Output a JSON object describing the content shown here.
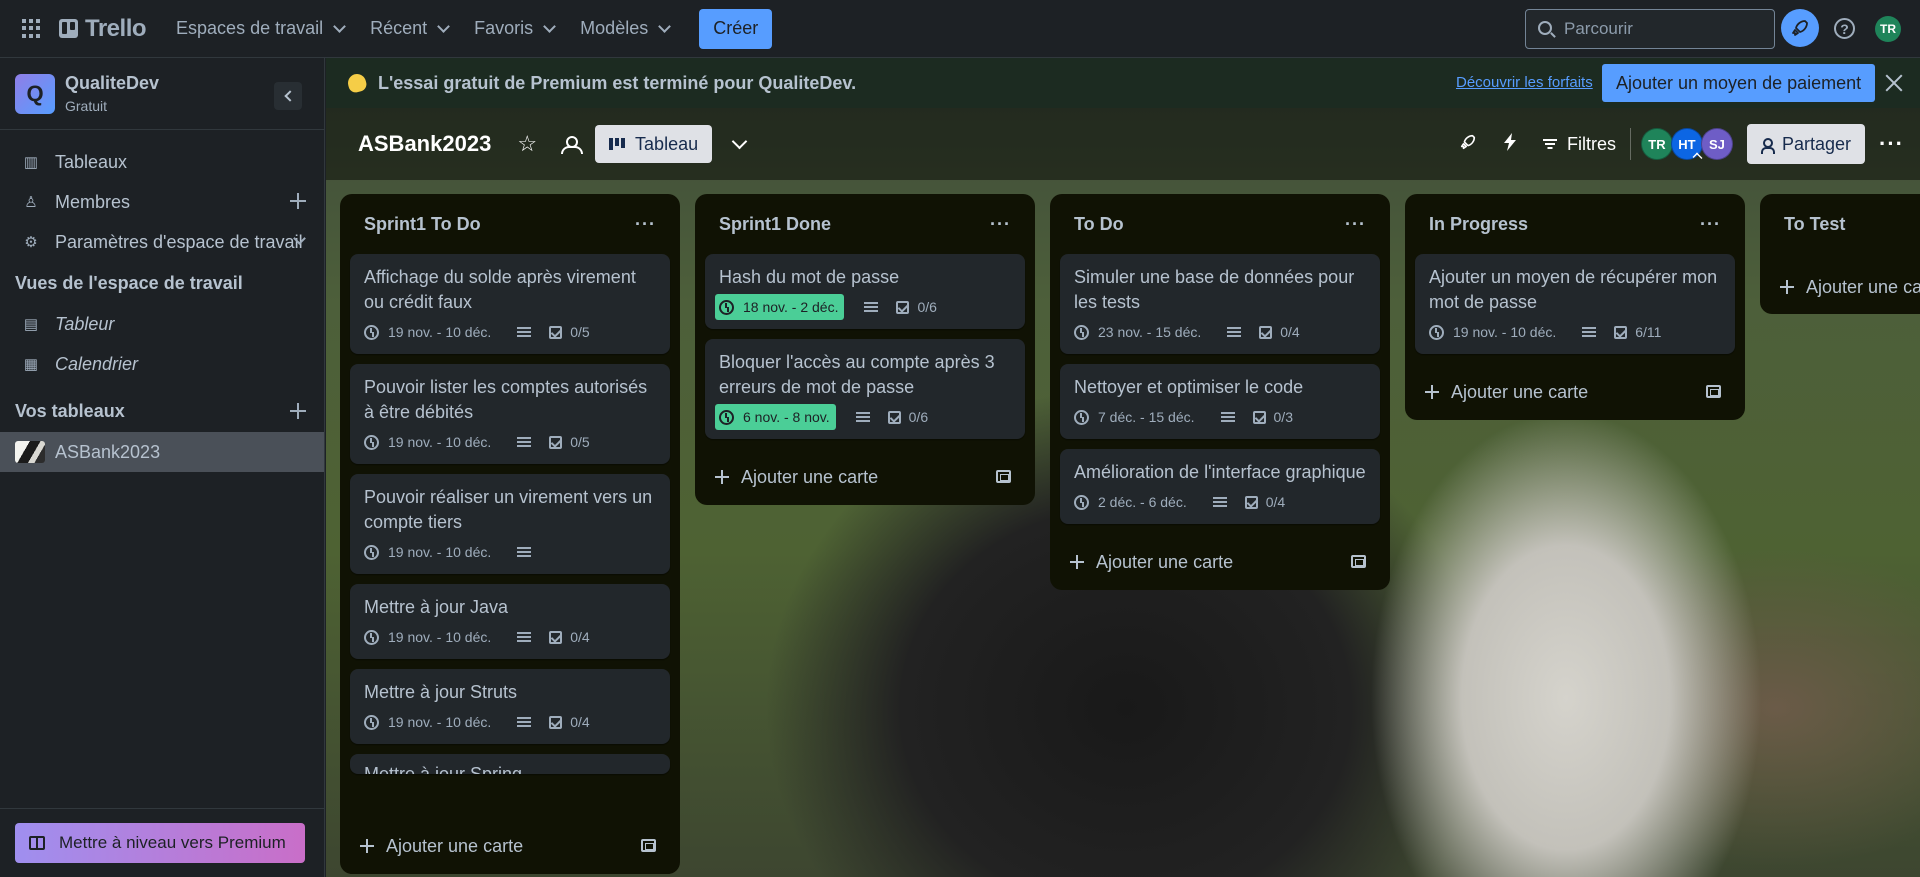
{
  "nav": {
    "logo": "Trello",
    "menus": [
      "Espaces de travail",
      "Récent",
      "Favoris",
      "Modèles"
    ],
    "create": "Créer",
    "search_placeholder": "Parcourir",
    "help": "?",
    "user_initials": "TR"
  },
  "sidebar": {
    "workspace_initial": "Q",
    "workspace_name": "QualiteDev",
    "workspace_plan": "Gratuit",
    "items": [
      {
        "label": "Tableaux",
        "icon": "trello-icon"
      },
      {
        "label": "Membres",
        "icon": "person-icon"
      },
      {
        "label": "Paramètres d'espace de travail",
        "icon": "gear-icon"
      }
    ],
    "views_heading": "Vues de l'espace de travail",
    "views": [
      {
        "label": "Tableur",
        "icon": "table-icon"
      },
      {
        "label": "Calendrier",
        "icon": "calendar-icon"
      }
    ],
    "boards_heading": "Vos tableaux",
    "boards": [
      "ASBank2023"
    ],
    "premium": "Mettre à niveau vers Premium"
  },
  "banner": {
    "text": "L'essai gratuit de Premium est terminé pour QualiteDev.",
    "link": "Découvrir les forfaits",
    "button": "Ajouter un moyen de paiement"
  },
  "board": {
    "title": "ASBank2023",
    "view": "Tableau",
    "filters": "Filtres",
    "share": "Partager",
    "members": [
      {
        "initials": "TR",
        "color": "#1f845a"
      },
      {
        "initials": "HT",
        "color": "#0c66e4"
      },
      {
        "initials": "SJ",
        "color": "#6e5dc6"
      }
    ]
  },
  "add_card_label": "Ajouter une carte",
  "lists": [
    {
      "title": "Sprint1 To Do",
      "cards": [
        {
          "title": "Affichage du solde après virement ou crédit faux",
          "date": "19 nov. - 10 déc.",
          "done": false,
          "description": true,
          "checklist": "0/5"
        },
        {
          "title": "Pouvoir lister les comptes autorisés à être débités",
          "date": "19 nov. - 10 déc.",
          "done": false,
          "description": true,
          "checklist": "0/5"
        },
        {
          "title": "Pouvoir réaliser un virement vers un compte tiers",
          "date": "19 nov. - 10 déc.",
          "done": false,
          "description": true,
          "checklist": ""
        },
        {
          "title": "Mettre à jour Java",
          "date": "19 nov. - 10 déc.",
          "done": false,
          "description": true,
          "checklist": "0/4"
        },
        {
          "title": "Mettre à jour Struts",
          "date": "19 nov. - 10 déc.",
          "done": false,
          "description": true,
          "checklist": "0/4"
        }
      ],
      "clipped_card": "Mettre à jour Spring"
    },
    {
      "title": "Sprint1 Done",
      "cards": [
        {
          "title": "Hash du mot de passe",
          "date": "18 nov. - 2 déc.",
          "done": true,
          "description": true,
          "checklist": "0/6"
        },
        {
          "title": "Bloquer l'accès au compte après 3 erreurs de mot de passe",
          "date": "6 nov. - 8 nov.",
          "done": true,
          "description": true,
          "checklist": "0/6"
        }
      ]
    },
    {
      "title": "To Do",
      "cards": [
        {
          "title": "Simuler une base de données pour les tests",
          "date": "23 nov. - 15 déc.",
          "done": false,
          "description": true,
          "checklist": "0/4"
        },
        {
          "title": "Nettoyer et optimiser le code",
          "date": "7 déc. - 15 déc.",
          "done": false,
          "description": true,
          "checklist": "0/3"
        },
        {
          "title": "Amélioration de l'interface graphique",
          "date": "2 déc. - 6 déc.",
          "done": false,
          "description": true,
          "checklist": "0/4"
        }
      ]
    },
    {
      "title": "In Progress",
      "cards": [
        {
          "title": "Ajouter un moyen de récupérer mon mot de passe",
          "date": "19 nov. - 10 déc.",
          "done": false,
          "description": true,
          "checklist": "6/11"
        }
      ]
    },
    {
      "title": "To Test",
      "cards": []
    }
  ],
  "colors": {
    "accent": "#579dff",
    "done_badge": "#4bce97",
    "list_bg": "#101204",
    "card_bg": "#22272b"
  }
}
